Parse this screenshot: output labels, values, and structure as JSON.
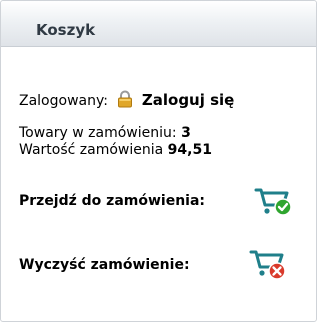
{
  "panel": {
    "title": "Koszyk"
  },
  "login": {
    "label": "Zalogowany:",
    "icon": "lock-icon",
    "link_text": "Zaloguj się"
  },
  "order": {
    "items_label": "Towary w zamówieniu:",
    "items_count": "3",
    "value_label": "Wartość zamówienia",
    "value": "94,51"
  },
  "actions": {
    "checkout_label": "Przejdź do zamówienia:",
    "checkout_icon": "cart-checkout-icon",
    "clear_label": "Wyczyść zamówienie:",
    "clear_icon": "cart-clear-icon"
  },
  "colors": {
    "accent_green": "#2fa52f",
    "accent_red": "#d93a2b",
    "cart_teal": "#1f7f8a",
    "lock_gold": "#e0a72a"
  }
}
